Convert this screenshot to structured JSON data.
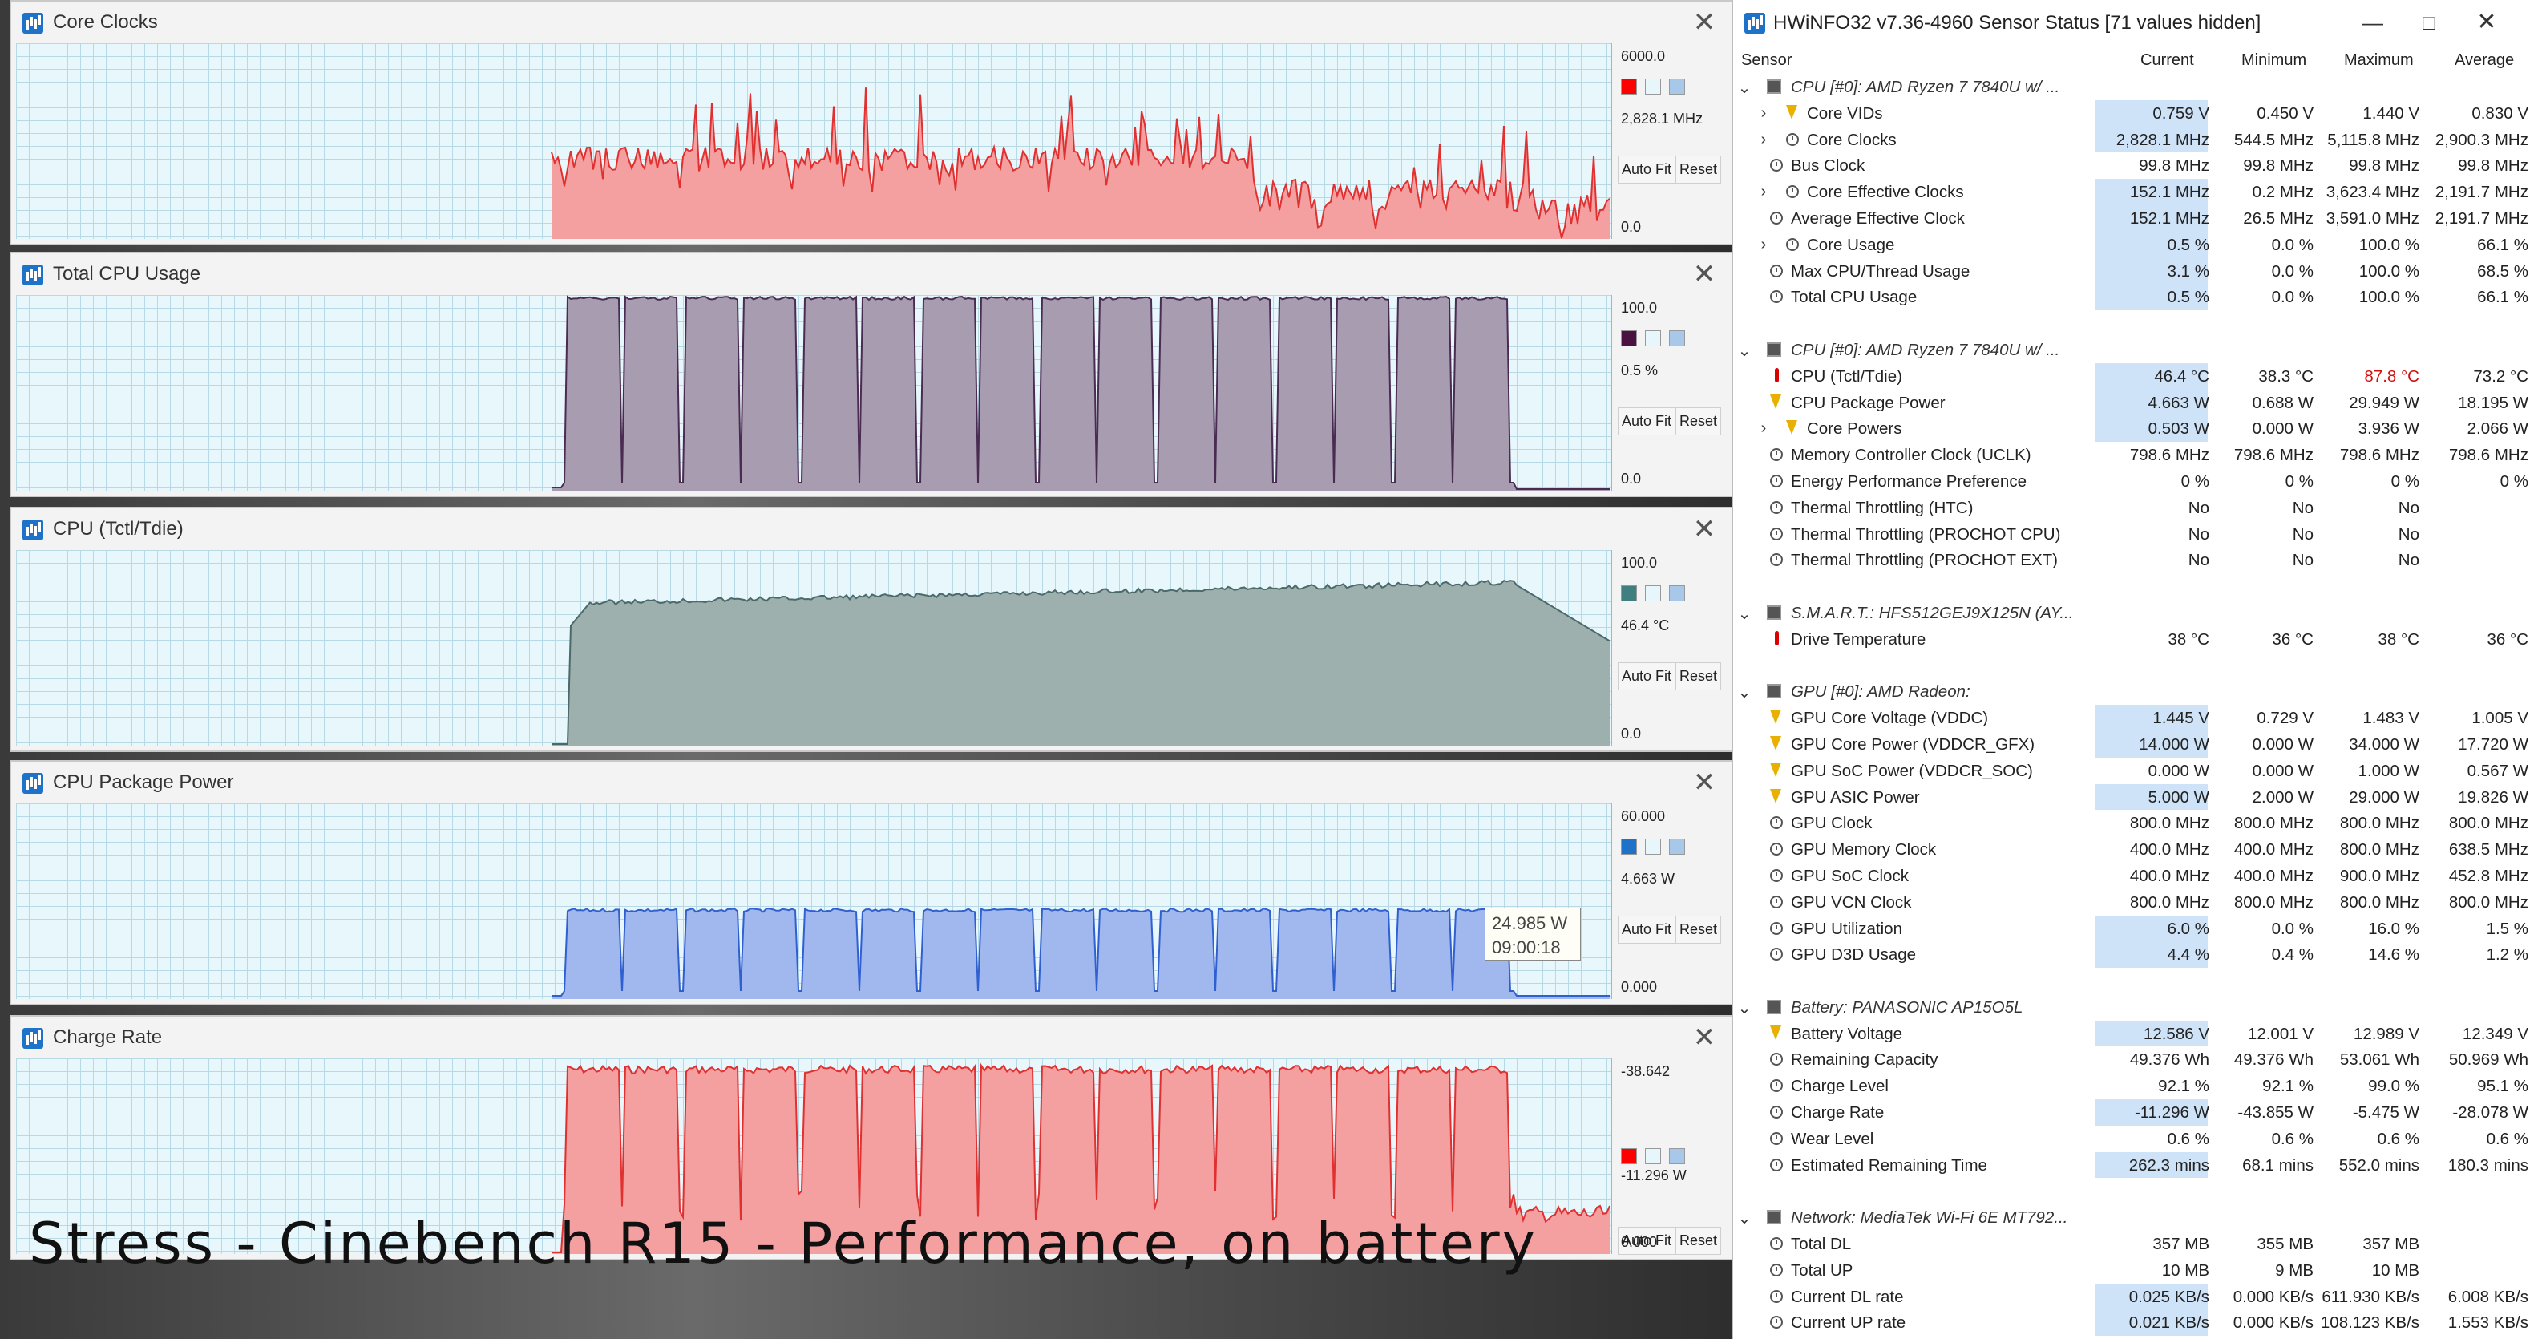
{
  "graphs": [
    {
      "title": "Core Clocks",
      "max": "6000.0",
      "current": "2,828.1 MHz",
      "min": "0.0",
      "color": "#f4a0a0",
      "stroke": "#e03030",
      "swatch": "#ff0000",
      "auto_fit": "Auto Fit",
      "reset": "Reset",
      "level": 0.47,
      "shape": "spiky"
    },
    {
      "title": "Total CPU Usage",
      "max": "100.0",
      "current": "0.5 %",
      "min": "0.0",
      "color": "#a89cb0",
      "stroke": "#4a2b52",
      "swatch": "#4b1140",
      "auto_fit": "Auto Fit",
      "reset": "Reset",
      "level": 1.0,
      "shape": "blocks"
    },
    {
      "title": "CPU (Tctl/Tdie)",
      "max": "100.0",
      "current": "46.4 °C",
      "min": "0.0",
      "color": "#9eb0ae",
      "stroke": "#4a6a6a",
      "swatch": "#3f7f7f",
      "auto_fit": "Auto Fit",
      "reset": "Reset",
      "level": 0.85,
      "shape": "temp"
    },
    {
      "title": "CPU Package Power",
      "max": "60.000",
      "current": "4.663 W",
      "min": "0.000",
      "color": "#a0b8ee",
      "stroke": "#3060d0",
      "swatch": "#1e73c8",
      "auto_fit": "Auto Fit",
      "reset": "Reset",
      "level": 0.47,
      "shape": "blocks"
    },
    {
      "title": "Charge Rate",
      "max": "-38.642",
      "current": "-11.296 W",
      "min": "0.000",
      "color": "#f4a0a0",
      "stroke": "#e03030",
      "swatch": "#ff0000",
      "auto_fit": "Auto Fit",
      "reset": "Reset",
      "level": 0.98,
      "shape": "charge"
    }
  ],
  "tooltip": {
    "value": "24.985 W",
    "time": "09:00:18"
  },
  "caption": "Stress - Cinebench R15 - Performance, on battery",
  "hwinfo": {
    "title": "HWiNFO32 v7.36-4960 Sensor Status [71 values hidden]",
    "columns": [
      "Sensor",
      "Current",
      "Minimum",
      "Maximum",
      "Average"
    ],
    "rows": [
      {
        "type": "group",
        "name": "CPU [#0]: AMD Ryzen 7 7840U w/ ..."
      },
      {
        "type": "row",
        "sub": true,
        "icon": "bolt",
        "name": "Core VIDs",
        "cur": "0.759 V",
        "min": "0.450 V",
        "max": "1.440 V",
        "avg": "0.830 V",
        "hl": true
      },
      {
        "type": "row",
        "sub": true,
        "icon": "clock",
        "name": "Core Clocks",
        "cur": "2,828.1 MHz",
        "min": "544.5 MHz",
        "max": "5,115.8 MHz",
        "avg": "2,900.3 MHz",
        "hl": true
      },
      {
        "type": "row",
        "icon": "clock",
        "name": "Bus Clock",
        "cur": "99.8 MHz",
        "min": "99.8 MHz",
        "max": "99.8 MHz",
        "avg": "99.8 MHz"
      },
      {
        "type": "row",
        "sub": true,
        "icon": "clock",
        "name": "Core Effective Clocks",
        "cur": "152.1 MHz",
        "min": "0.2 MHz",
        "max": "3,623.4 MHz",
        "avg": "2,191.7 MHz",
        "hl": true
      },
      {
        "type": "row",
        "icon": "clock",
        "name": "Average Effective Clock",
        "cur": "152.1 MHz",
        "min": "26.5 MHz",
        "max": "3,591.0 MHz",
        "avg": "2,191.7 MHz",
        "hl": true
      },
      {
        "type": "row",
        "sub": true,
        "icon": "clock",
        "name": "Core Usage",
        "cur": "0.5 %",
        "min": "0.0 %",
        "max": "100.0 %",
        "avg": "66.1 %",
        "hl": true
      },
      {
        "type": "row",
        "icon": "clock",
        "name": "Max CPU/Thread Usage",
        "cur": "3.1 %",
        "min": "0.0 %",
        "max": "100.0 %",
        "avg": "68.5 %",
        "hl": true
      },
      {
        "type": "row",
        "icon": "clock",
        "name": "Total CPU Usage",
        "cur": "0.5 %",
        "min": "0.0 %",
        "max": "100.0 %",
        "avg": "66.1 %",
        "hl": true
      },
      {
        "type": "blank"
      },
      {
        "type": "group",
        "name": "CPU [#0]: AMD Ryzen 7 7840U w/ ..."
      },
      {
        "type": "row",
        "icon": "therm",
        "name": "CPU (Tctl/Tdie)",
        "cur": "46.4 °C",
        "min": "38.3 °C",
        "max": "87.8 °C",
        "avg": "73.2 °C",
        "hl": true,
        "maxred": true
      },
      {
        "type": "row",
        "icon": "bolt",
        "name": "CPU Package Power",
        "cur": "4.663 W",
        "min": "0.688 W",
        "max": "29.949 W",
        "avg": "18.195 W",
        "hl": true
      },
      {
        "type": "row",
        "sub": true,
        "icon": "bolt",
        "name": "Core Powers",
        "cur": "0.503 W",
        "min": "0.000 W",
        "max": "3.936 W",
        "avg": "2.066 W",
        "hl": true
      },
      {
        "type": "row",
        "icon": "clock",
        "name": "Memory Controller Clock (UCLK)",
        "cur": "798.6 MHz",
        "min": "798.6 MHz",
        "max": "798.6 MHz",
        "avg": "798.6 MHz"
      },
      {
        "type": "row",
        "icon": "clock",
        "name": "Energy Performance Preference",
        "cur": "0 %",
        "min": "0 %",
        "max": "0 %",
        "avg": "0 %"
      },
      {
        "type": "row",
        "icon": "clock",
        "name": "Thermal Throttling (HTC)",
        "cur": "No",
        "min": "No",
        "max": "No",
        "avg": ""
      },
      {
        "type": "row",
        "icon": "clock",
        "name": "Thermal Throttling (PROCHOT CPU)",
        "cur": "No",
        "min": "No",
        "max": "No",
        "avg": ""
      },
      {
        "type": "row",
        "icon": "clock",
        "name": "Thermal Throttling (PROCHOT EXT)",
        "cur": "No",
        "min": "No",
        "max": "No",
        "avg": ""
      },
      {
        "type": "blank"
      },
      {
        "type": "group",
        "name": "S.M.A.R.T.: HFS512GEJ9X125N (AY..."
      },
      {
        "type": "row",
        "icon": "therm",
        "name": "Drive Temperature",
        "cur": "38 °C",
        "min": "36 °C",
        "max": "38 °C",
        "avg": "36 °C"
      },
      {
        "type": "blank"
      },
      {
        "type": "group",
        "name": "GPU [#0]: AMD Radeon:"
      },
      {
        "type": "row",
        "icon": "bolt",
        "name": "GPU Core Voltage (VDDC)",
        "cur": "1.445 V",
        "min": "0.729 V",
        "max": "1.483 V",
        "avg": "1.005 V",
        "hl": true
      },
      {
        "type": "row",
        "icon": "bolt",
        "name": "GPU Core Power (VDDCR_GFX)",
        "cur": "14.000 W",
        "min": "0.000 W",
        "max": "34.000 W",
        "avg": "17.720 W",
        "hl": true
      },
      {
        "type": "row",
        "icon": "bolt",
        "name": "GPU SoC Power (VDDCR_SOC)",
        "cur": "0.000 W",
        "min": "0.000 W",
        "max": "1.000 W",
        "avg": "0.567 W"
      },
      {
        "type": "row",
        "icon": "bolt",
        "name": "GPU ASIC Power",
        "cur": "5.000 W",
        "min": "2.000 W",
        "max": "29.000 W",
        "avg": "19.826 W",
        "hl": true
      },
      {
        "type": "row",
        "icon": "clock",
        "name": "GPU Clock",
        "cur": "800.0 MHz",
        "min": "800.0 MHz",
        "max": "800.0 MHz",
        "avg": "800.0 MHz"
      },
      {
        "type": "row",
        "icon": "clock",
        "name": "GPU Memory Clock",
        "cur": "400.0 MHz",
        "min": "400.0 MHz",
        "max": "800.0 MHz",
        "avg": "638.5 MHz"
      },
      {
        "type": "row",
        "icon": "clock",
        "name": "GPU SoC Clock",
        "cur": "400.0 MHz",
        "min": "400.0 MHz",
        "max": "900.0 MHz",
        "avg": "452.8 MHz"
      },
      {
        "type": "row",
        "icon": "clock",
        "name": "GPU VCN Clock",
        "cur": "800.0 MHz",
        "min": "800.0 MHz",
        "max": "800.0 MHz",
        "avg": "800.0 MHz"
      },
      {
        "type": "row",
        "icon": "clock",
        "name": "GPU Utilization",
        "cur": "6.0 %",
        "min": "0.0 %",
        "max": "16.0 %",
        "avg": "1.5 %",
        "hl": true
      },
      {
        "type": "row",
        "icon": "clock",
        "name": "GPU D3D Usage",
        "cur": "4.4 %",
        "min": "0.4 %",
        "max": "14.6 %",
        "avg": "1.2 %",
        "hl": true
      },
      {
        "type": "blank"
      },
      {
        "type": "group",
        "name": "Battery: PANASONIC AP15O5L"
      },
      {
        "type": "row",
        "icon": "bolt",
        "name": "Battery Voltage",
        "cur": "12.586 V",
        "min": "12.001 V",
        "max": "12.989 V",
        "avg": "12.349 V",
        "hl": true
      },
      {
        "type": "row",
        "icon": "clock",
        "name": "Remaining Capacity",
        "cur": "49.376 Wh",
        "min": "49.376 Wh",
        "max": "53.061 Wh",
        "avg": "50.969 Wh"
      },
      {
        "type": "row",
        "icon": "clock",
        "name": "Charge Level",
        "cur": "92.1 %",
        "min": "92.1 %",
        "max": "99.0 %",
        "avg": "95.1 %"
      },
      {
        "type": "row",
        "icon": "clock",
        "name": "Charge Rate",
        "cur": "-11.296 W",
        "min": "-43.855 W",
        "max": "-5.475 W",
        "avg": "-28.078 W",
        "hl": true
      },
      {
        "type": "row",
        "icon": "clock",
        "name": "Wear Level",
        "cur": "0.6 %",
        "min": "0.6 %",
        "max": "0.6 %",
        "avg": "0.6 %"
      },
      {
        "type": "row",
        "icon": "clock",
        "name": "Estimated Remaining Time",
        "cur": "262.3 mins",
        "min": "68.1 mins",
        "max": "552.0 mins",
        "avg": "180.3 mins",
        "hl": true
      },
      {
        "type": "blank"
      },
      {
        "type": "group",
        "name": "Network: MediaTek Wi-Fi 6E MT792..."
      },
      {
        "type": "row",
        "icon": "clock",
        "name": "Total DL",
        "cur": "357 MB",
        "min": "355 MB",
        "max": "357 MB",
        "avg": ""
      },
      {
        "type": "row",
        "icon": "clock",
        "name": "Total UP",
        "cur": "10 MB",
        "min": "9 MB",
        "max": "10 MB",
        "avg": ""
      },
      {
        "type": "row",
        "icon": "clock",
        "name": "Current DL rate",
        "cur": "0.025 KB/s",
        "min": "0.000 KB/s",
        "max": "611.930 KB/s",
        "avg": "6.008 KB/s",
        "hl": true
      },
      {
        "type": "row",
        "icon": "clock",
        "name": "Current UP rate",
        "cur": "0.021 KB/s",
        "min": "0.000 KB/s",
        "max": "108.123 KB/s",
        "avg": "1.553 KB/s",
        "hl": true
      }
    ]
  }
}
